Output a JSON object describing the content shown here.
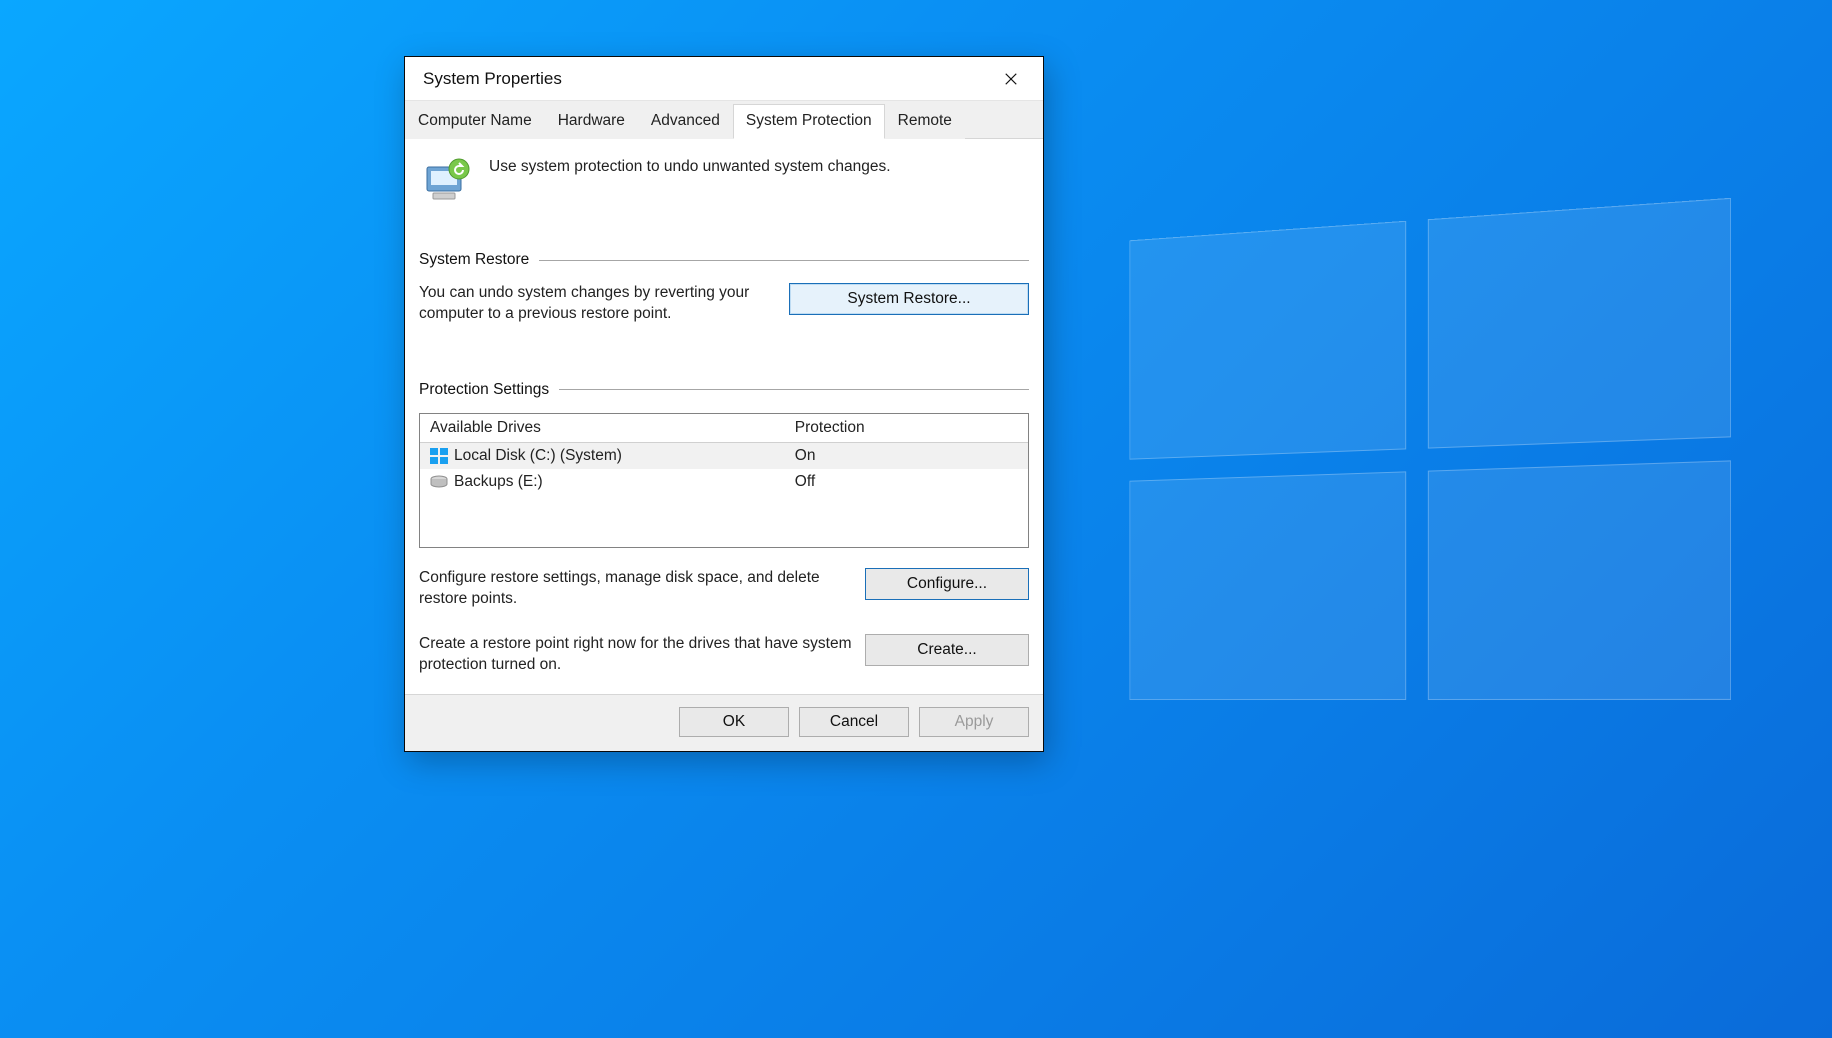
{
  "window": {
    "title": "System Properties"
  },
  "tabs": [
    "Computer Name",
    "Hardware",
    "Advanced",
    "System Protection",
    "Remote"
  ],
  "active_tab_index": 3,
  "intro": "Use system protection to undo unwanted system changes.",
  "groups": {
    "restore": {
      "title": "System Restore",
      "desc": "You can undo system changes by reverting your computer to a previous restore point.",
      "button": "System Restore..."
    },
    "settings": {
      "title": "Protection Settings",
      "columns": [
        "Available Drives",
        "Protection"
      ],
      "drives": [
        {
          "name": "Local Disk (C:) (System)",
          "protection": "On",
          "icon": "windows-drive-icon",
          "selected": true
        },
        {
          "name": "Backups (E:)",
          "protection": "Off",
          "icon": "drive-icon",
          "selected": false
        }
      ],
      "configure_desc": "Configure restore settings, manage disk space, and delete restore points.",
      "configure_button": "Configure...",
      "create_desc": "Create a restore point right now for the drives that have system protection turned on.",
      "create_button": "Create..."
    }
  },
  "footer": {
    "ok": "OK",
    "cancel": "Cancel",
    "apply": "Apply"
  }
}
